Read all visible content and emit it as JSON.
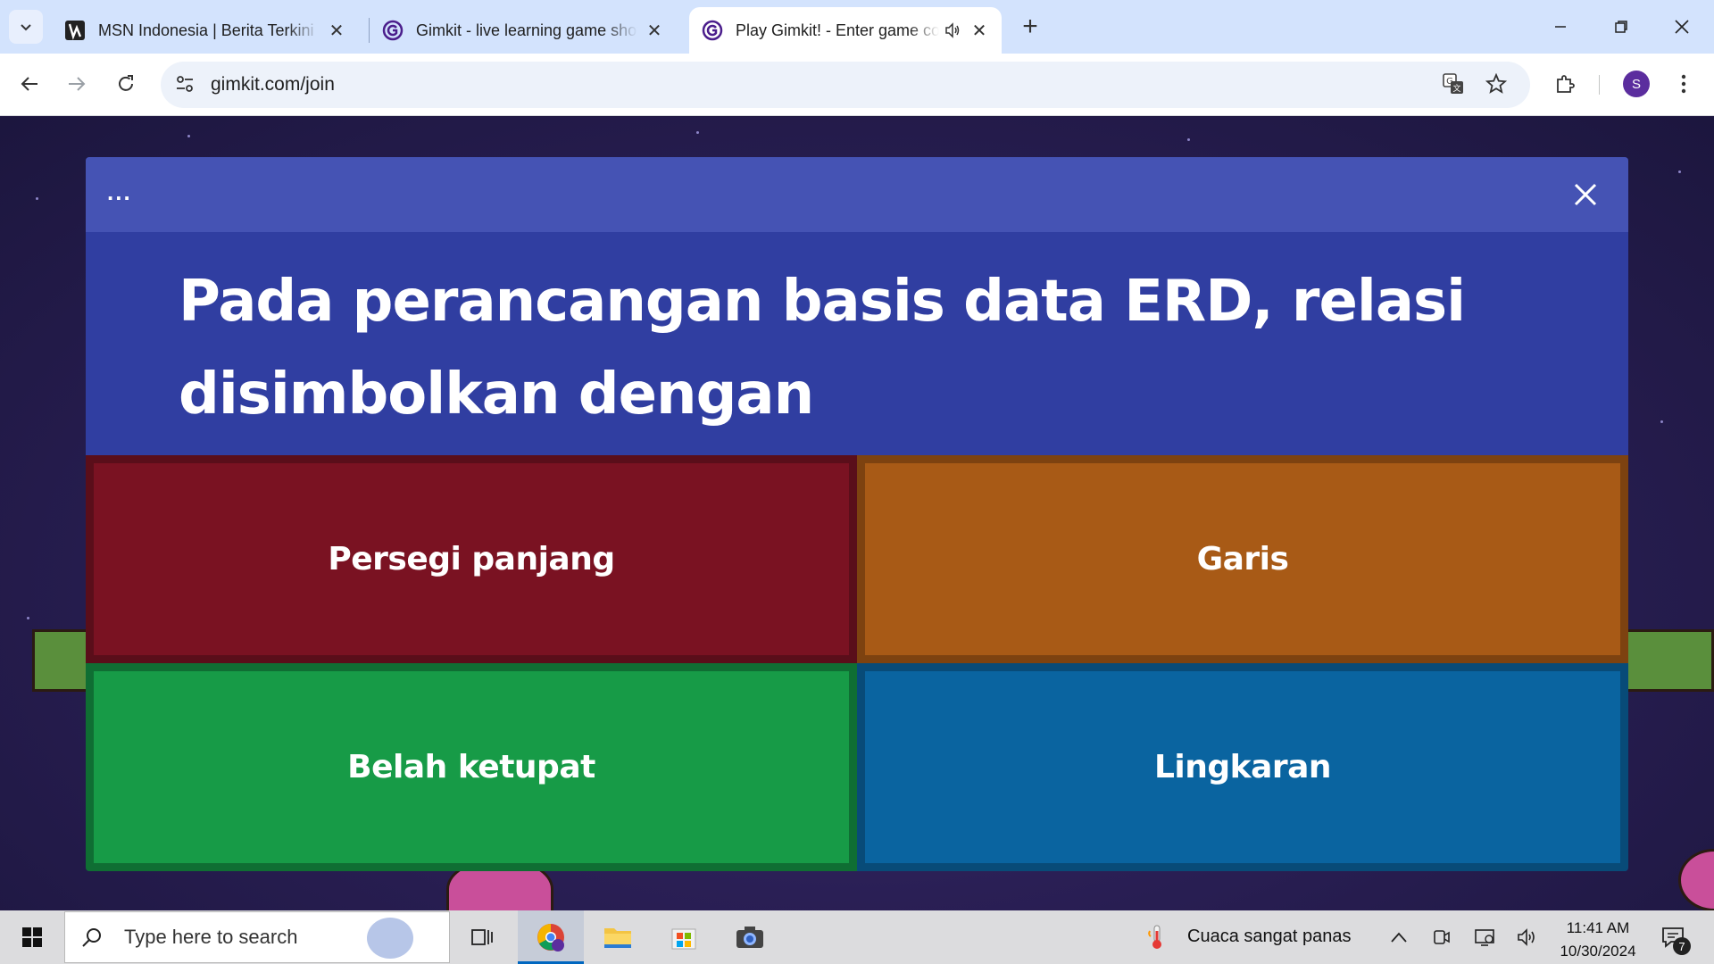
{
  "browser": {
    "tabs": [
      {
        "title": "MSN Indonesia | Berita Terkini Hari Ini",
        "icon": "msn-icon",
        "active": false
      },
      {
        "title": "Gimkit - live learning game show",
        "icon": "gimkit-icon",
        "active": false
      },
      {
        "title": "Play Gimkit! - Enter game code",
        "icon": "gimkit-icon",
        "active": true,
        "audio": true
      }
    ],
    "url": "gimkit.com/join",
    "profile_initial": "S"
  },
  "game": {
    "menu_dots": "...",
    "question": "Pada perancangan basis data ERD, relasi disimbolkan dengan",
    "answers": [
      {
        "label": "Persegi panjang",
        "color": "#7a1222",
        "border": "#5a0e1a"
      },
      {
        "label": "Garis",
        "color": "#a85a16",
        "border": "#7d4210"
      },
      {
        "label": "Belah ketupat",
        "color": "#179b47",
        "border": "#0f6e33"
      },
      {
        "label": "Lingkaran",
        "color": "#0a64a0",
        "border": "#084b78"
      }
    ]
  },
  "taskbar": {
    "search_placeholder": "Type here to search",
    "weather": "Cuaca sangat panas",
    "time": "11:41 AM",
    "date": "10/30/2024",
    "notification_count": "7"
  }
}
